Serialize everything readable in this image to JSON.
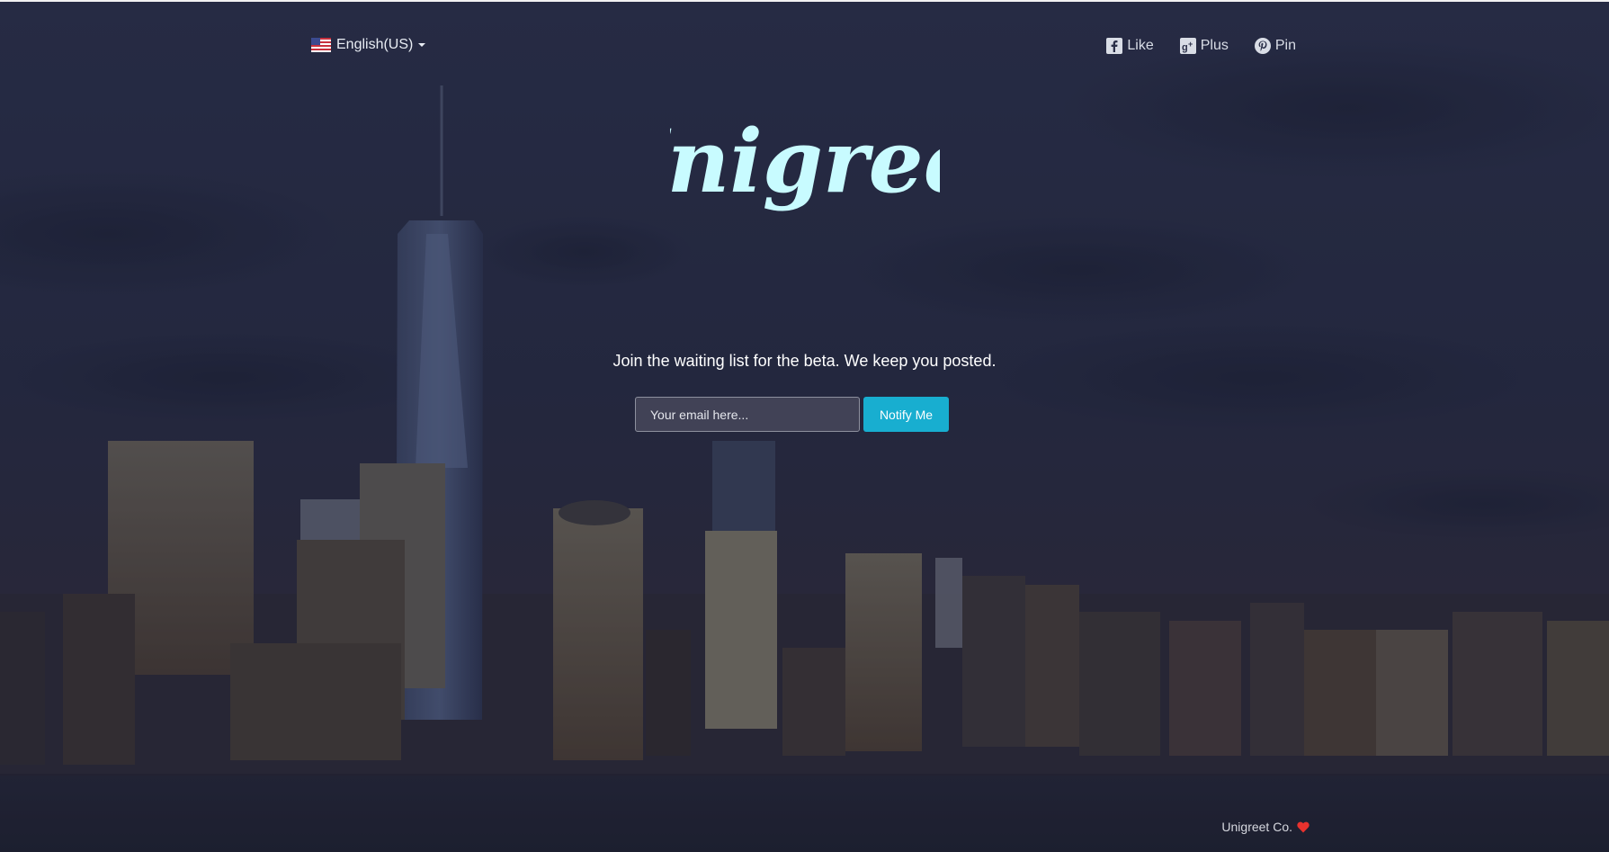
{
  "language": {
    "label": "English(US)",
    "flag": "us-flag-icon"
  },
  "social": [
    {
      "label": "Like",
      "icon": "facebook-icon"
    },
    {
      "label": "Plus",
      "icon": "google-plus-icon"
    },
    {
      "label": "Pin",
      "icon": "pinterest-icon"
    }
  ],
  "brand": {
    "logo_text": "Unigreet",
    "logo_color": "#c8fbff"
  },
  "signup": {
    "tagline": "Join the waiting list for the beta. We keep you posted.",
    "email_placeholder": "Your email here...",
    "button_label": "Notify Me",
    "button_color": "#18aed0"
  },
  "footer": {
    "text": "Unigreet Co.",
    "heart_color": "#e8322e"
  }
}
